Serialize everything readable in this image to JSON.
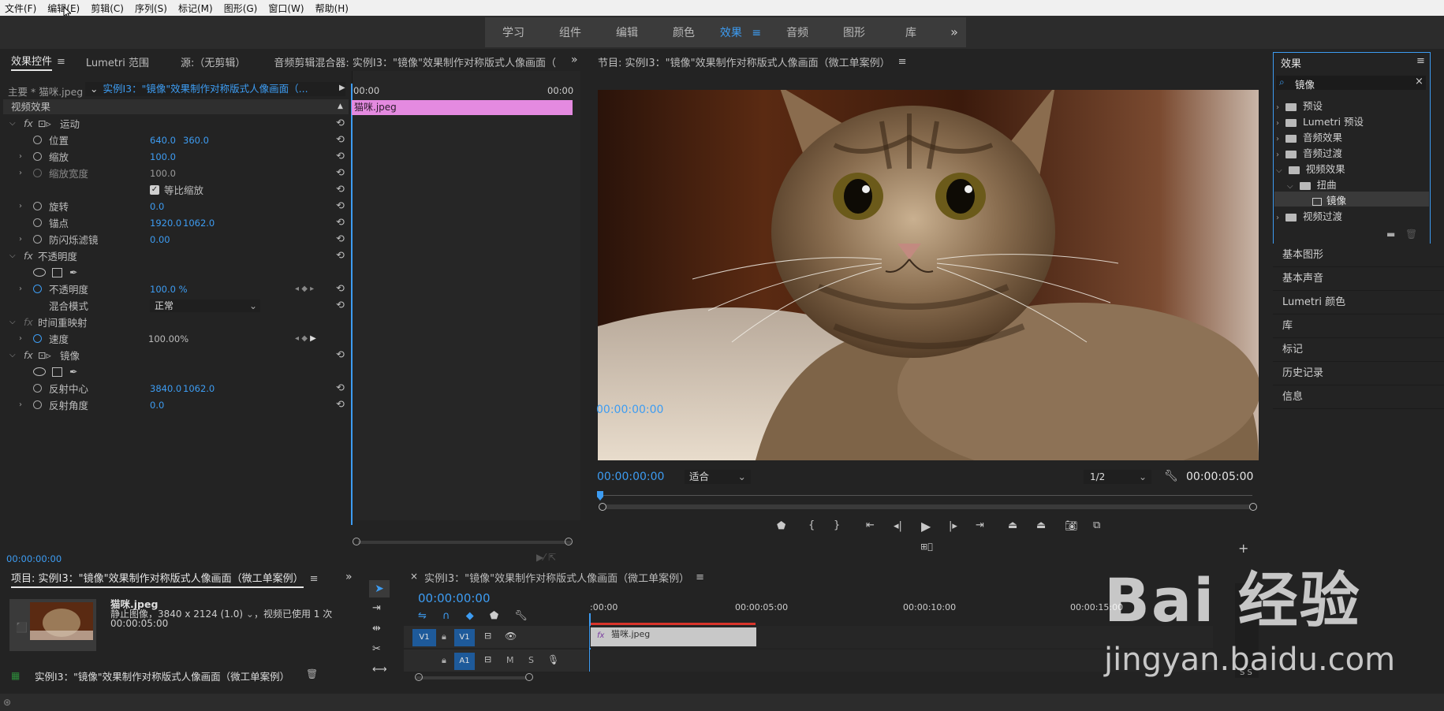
{
  "menu": [
    "文件(F)",
    "编辑(E)",
    "剪辑(C)",
    "序列(S)",
    "标记(M)",
    "图形(G)",
    "窗口(W)",
    "帮助(H)"
  ],
  "workspaces": {
    "items": [
      "学习",
      "组件",
      "编辑",
      "颜色",
      "效果",
      "音频",
      "图形",
      "库"
    ],
    "active": "效果",
    "more": "»"
  },
  "effect_controls": {
    "tabs": {
      "effect_controls": "效果控件",
      "lumetri_scopes": "Lumetri 范围",
      "source": "源:（无剪辑）",
      "audio_mixer": "音频剪辑混合器: 实例I3：\"镜像\"效果制作对称版式人像画面（"
    },
    "more": "»",
    "master": "主要 * 猫咪.jpeg",
    "sequence": "实例I3：\"镜像\"效果制作对称版式人像画面（...",
    "ruler_start": "00:00",
    "ruler_end": "00:00",
    "clip_label": "猫咪.jpeg",
    "section": "视频效果",
    "motion": "运动",
    "position": {
      "label": "位置",
      "x": "640.0",
      "y": "360.0"
    },
    "scale": {
      "label": "缩放",
      "value": "100.0"
    },
    "scale_width": {
      "label": "缩放宽度",
      "value": "100.0"
    },
    "uniform_scale": "等比缩放",
    "rotation": {
      "label": "旋转",
      "value": "0.0"
    },
    "anchor": {
      "label": "锚点",
      "x": "1920.0",
      "y": "1062.0"
    },
    "antiflicker": {
      "label": "防闪烁滤镜",
      "value": "0.00"
    },
    "opacity_group": "不透明度",
    "opacity": {
      "label": "不透明度",
      "value": "100.0 %"
    },
    "blend": {
      "label": "混合模式",
      "value": "正常"
    },
    "time_remap": "时间重映射",
    "speed": {
      "label": "速度",
      "value": "100.00%"
    },
    "mirror": "镜像",
    "reflect_center": {
      "label": "反射中心",
      "x": "3840.0",
      "y": "1062.0"
    },
    "reflect_angle": {
      "label": "反射角度",
      "value": "0.0"
    },
    "timecode": "00:00:00:00"
  },
  "program": {
    "title": "节目: 实例I3：\"镜像\"效果制作对称版式人像画面（微工单案例）",
    "timecode": "00:00:00:00",
    "fit": "适合",
    "quality": "1/2",
    "duration": "00:00:05:00"
  },
  "effects_panel": {
    "title": "效果",
    "search_value": "镜像",
    "tree": [
      "预设",
      "Lumetri 预设",
      "音频效果",
      "音频过渡",
      "视频效果",
      "扭曲",
      "镜像",
      "视频过渡"
    ]
  },
  "side_panels": [
    "基本图形",
    "基本声音",
    "Lumetri 颜色",
    "库",
    "标记",
    "历史记录",
    "信息"
  ],
  "project": {
    "title": "项目: 实例I3：\"镜像\"效果制作对称版式人像画面（微工单案例）",
    "item_name": "猫咪.jpeg",
    "item_info": "静止图像，3840 x 2124 (1.0)",
    "item_usage": "，视频已使用 1 次",
    "item_duration": "00:00:05:00",
    "footer_text": "实例I3：\"镜像\"效果制作对称版式人像画面（微工单案例）"
  },
  "timeline": {
    "title": "实例I3：\"镜像\"效果制作对称版式人像画面（微工单案例）",
    "timecode": "00:00:00:00",
    "ruler": [
      ":00:00",
      "00:00:05:00",
      "00:00:10:00",
      "00:00:15:00"
    ],
    "v1": "V1",
    "a1": "A1",
    "clip": "猫咪.jpeg",
    "m": "M",
    "s": "S"
  },
  "watermark": {
    "text": "Bai  经验",
    "url": "jingyan.baidu.com"
  },
  "colors": {
    "accent": "#3d9cf2",
    "clip_pink": "#e48ae0",
    "playhead_red": "#d9342b"
  }
}
